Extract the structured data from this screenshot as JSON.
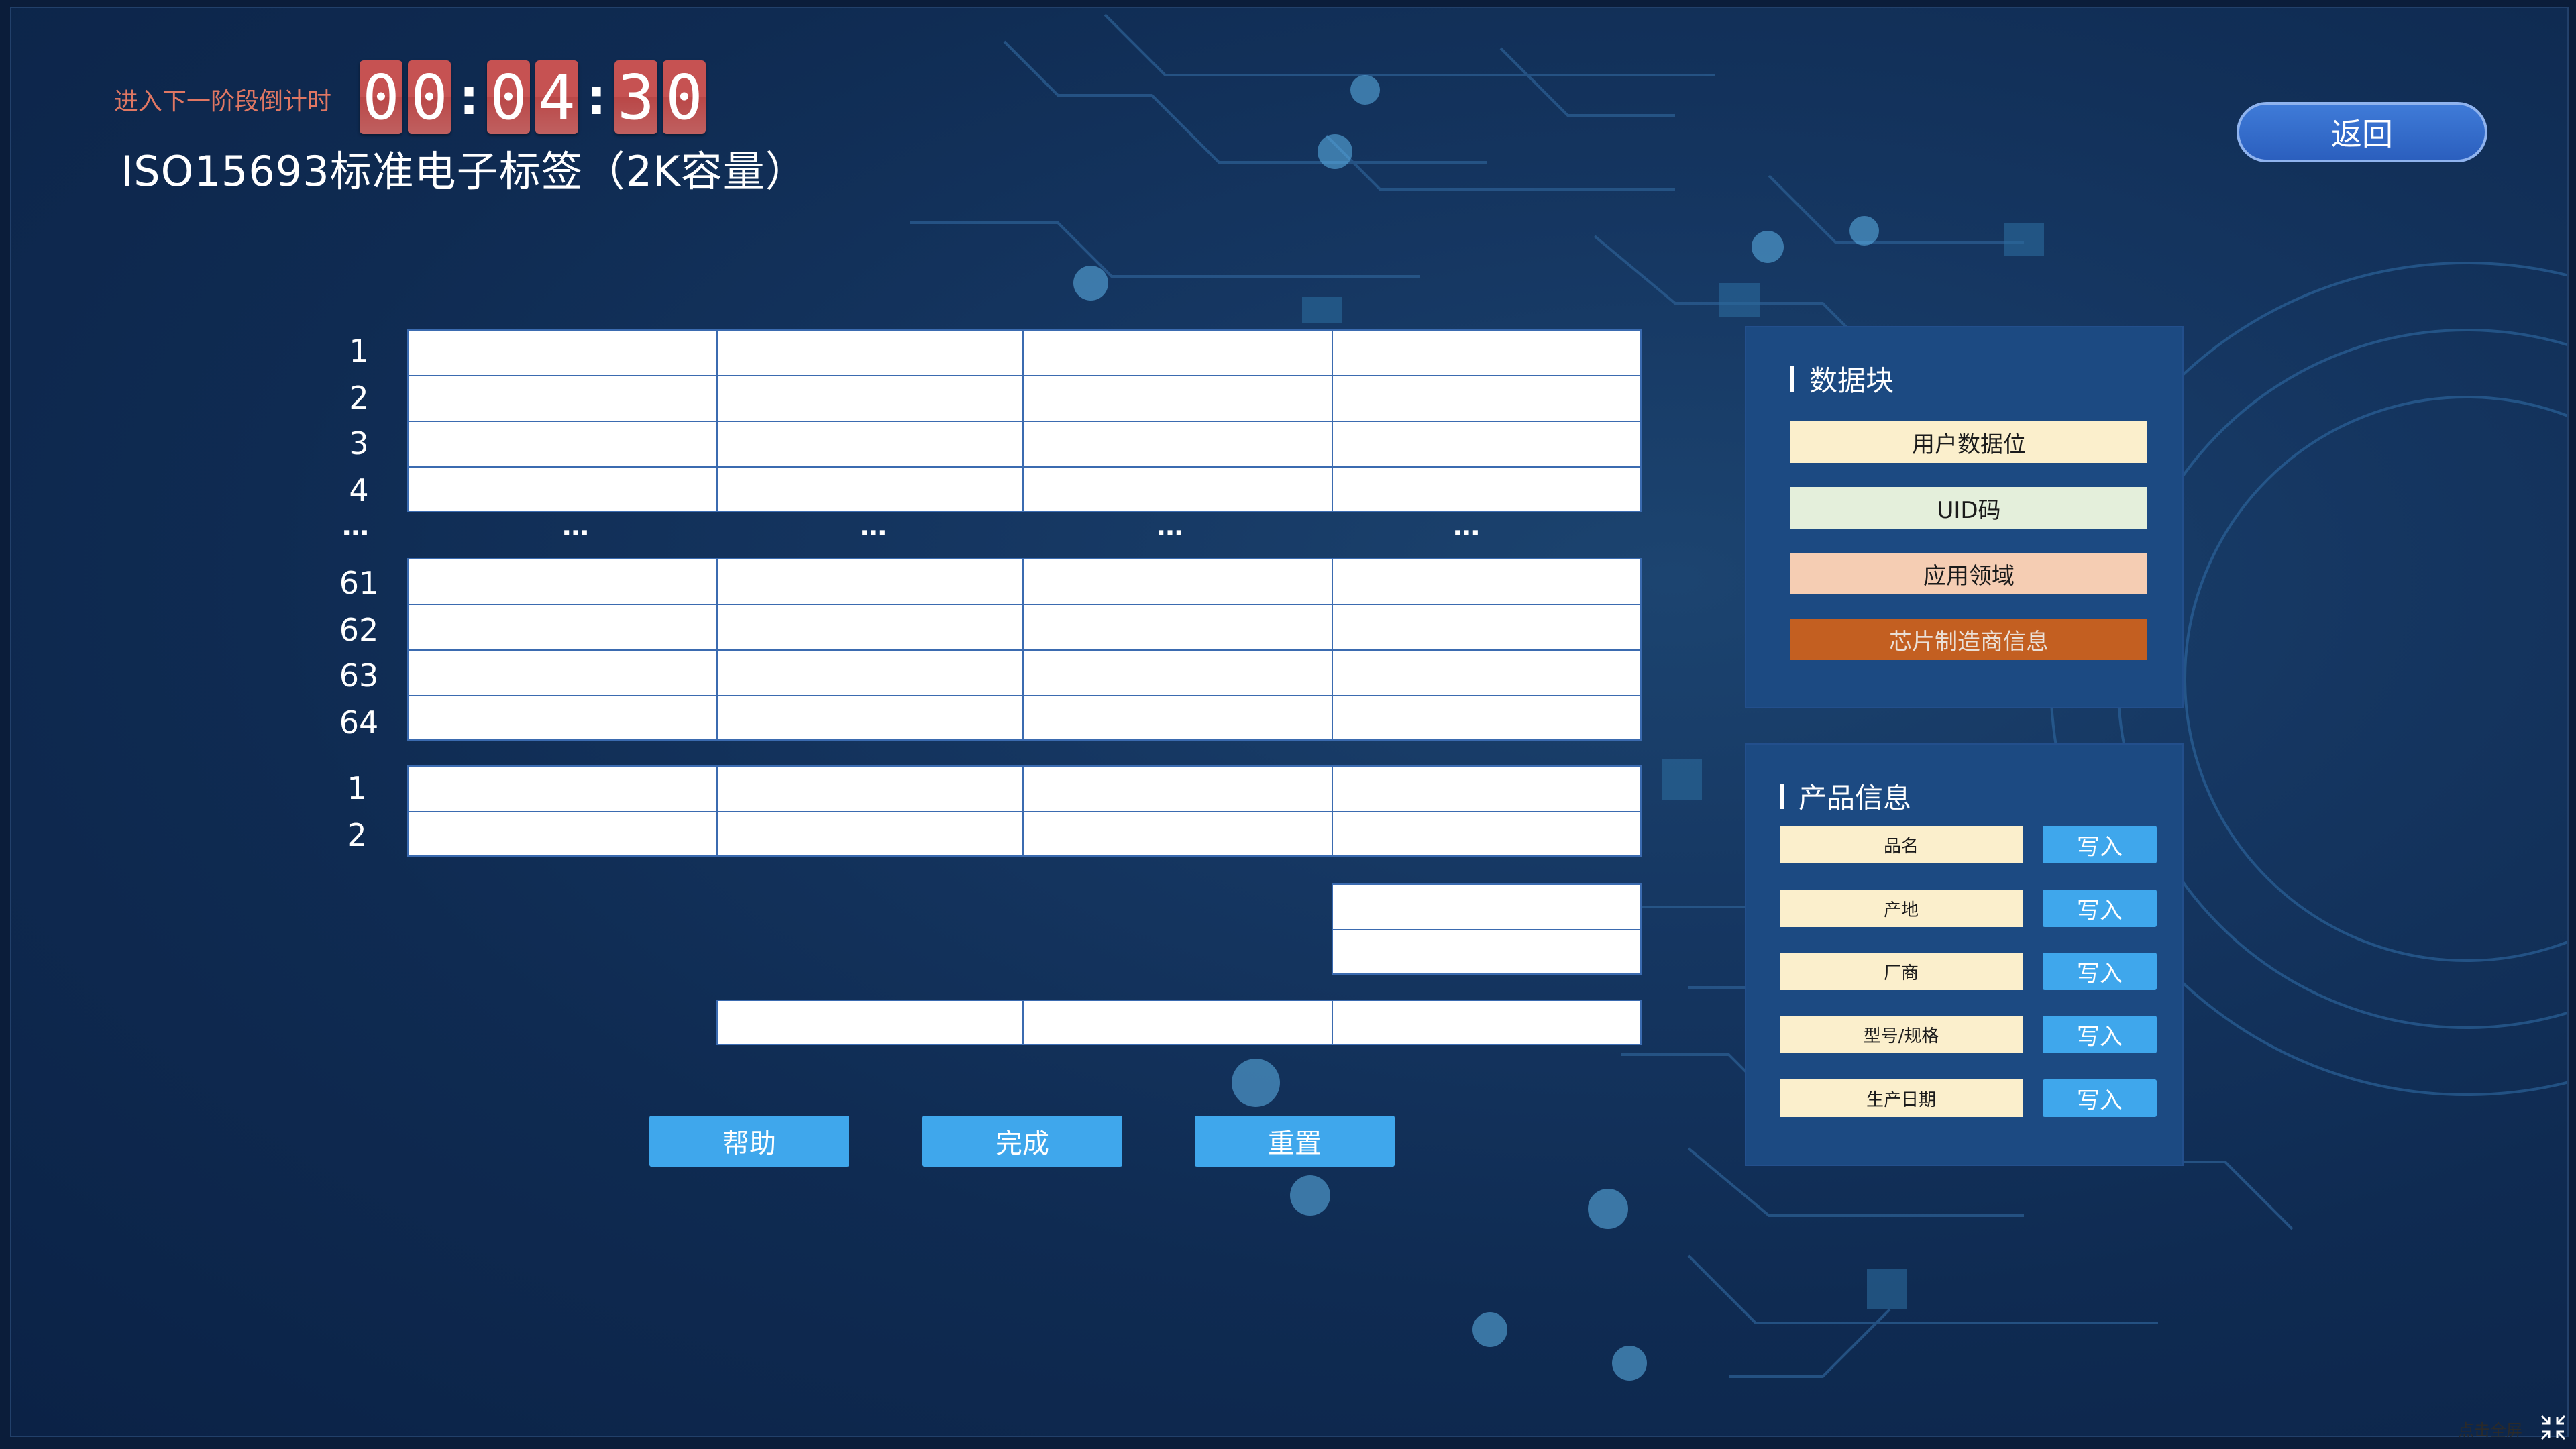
{
  "countdown": {
    "label": "进入下一阶段倒计时",
    "d1": "0",
    "d2": "0",
    "sep1": ":",
    "d3": "0",
    "d4": "4",
    "sep2": ":",
    "d5": "3",
    "d6": "0"
  },
  "title": "ISO15693标准电子标签（2K容量）",
  "back_label": "返回",
  "memory_table": {
    "row_numbers_top": [
      "1",
      "2",
      "3",
      "4"
    ],
    "ellipsis": "…",
    "row_numbers_bottom": [
      "61",
      "62",
      "63",
      "64"
    ],
    "extra_row_numbers": [
      "1",
      "2"
    ]
  },
  "buttons": {
    "help": "帮助",
    "done": "完成",
    "reset": "重置"
  },
  "data_block_panel": {
    "title": "数据块",
    "legend": [
      {
        "label": "用户数据位",
        "color": "#fbefcc"
      },
      {
        "label": "UID码",
        "color": "#e4efdb"
      },
      {
        "label": "应用领域",
        "color": "#f5cdb3"
      },
      {
        "label": "芯片制造商信息",
        "color": "#c35f21"
      }
    ]
  },
  "product_panel": {
    "title": "产品信息",
    "write_label": "写入",
    "items": [
      "品名",
      "产地",
      "厂商",
      "型号/规格",
      "生产日期"
    ]
  },
  "fullscreen_label": "点击全屏",
  "colors": {
    "accent_button": "#3fa7ec",
    "countdown_digit": "#c65252",
    "background": "#0f2b52"
  }
}
